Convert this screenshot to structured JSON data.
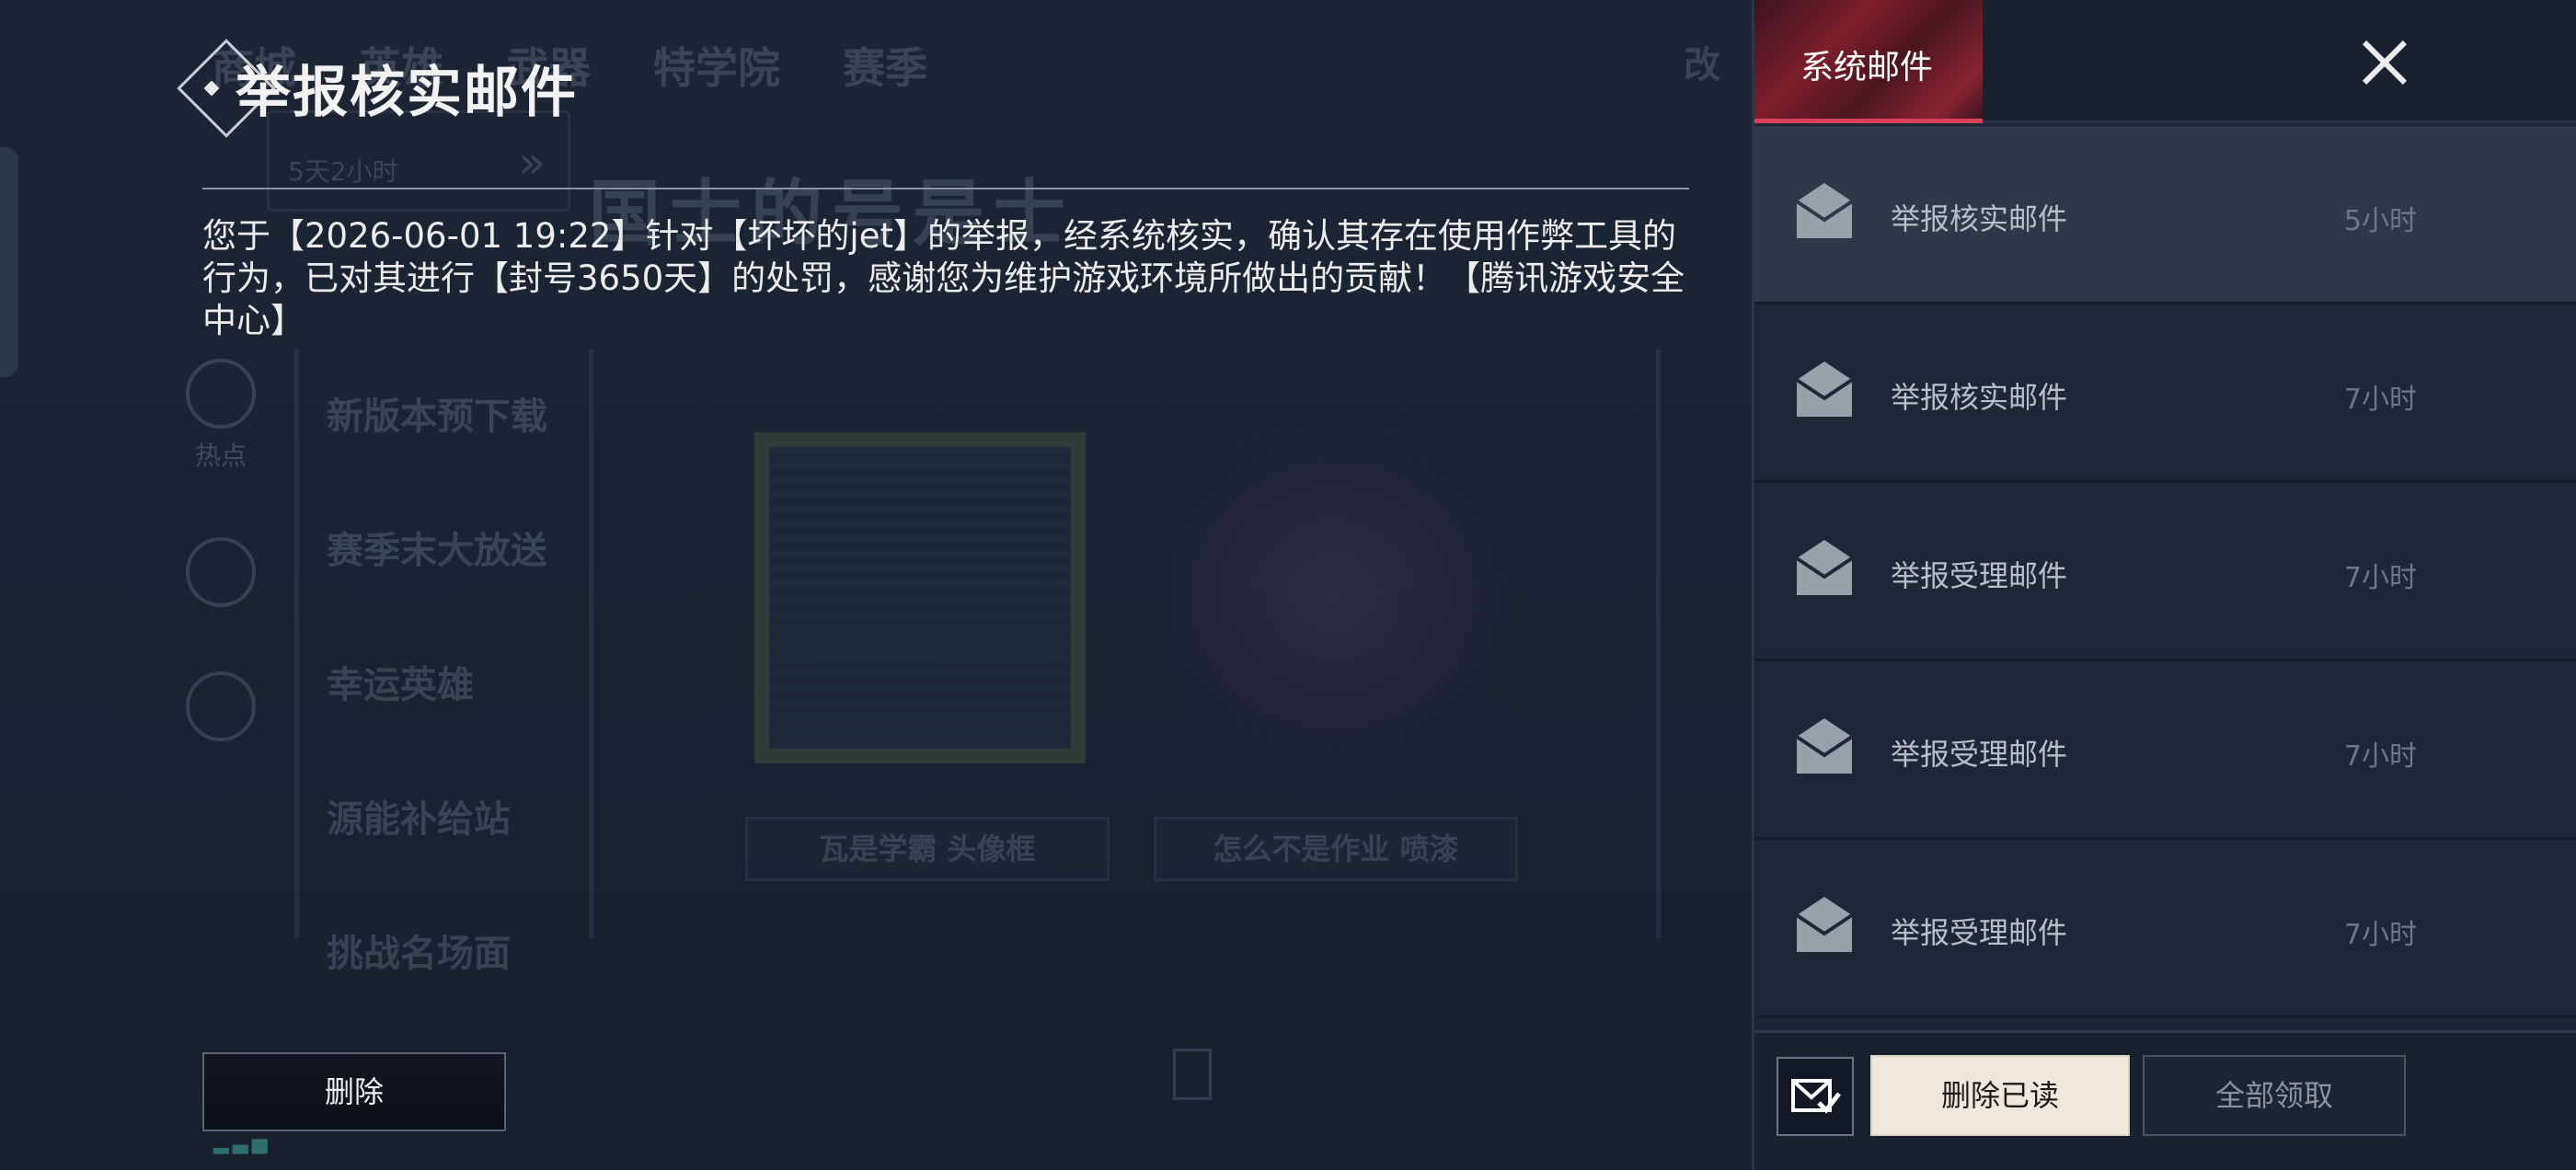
{
  "detail": {
    "title": "举报核实邮件",
    "body": "您于【2026-06-01 19:22】针对【坏坏的jet】的举报，经系统核实，确认其存在使用作弊工具的行为，已对其进行【封号3650天】的处罚，感谢您为维护游戏环境所做出的贡献！【腾讯游戏安全中心】",
    "delete_label": "删除"
  },
  "sidebar": {
    "tab_label": "系统邮件",
    "mails": [
      {
        "name": "举报核实邮件",
        "time": "5小时",
        "active": true
      },
      {
        "name": "举报核实邮件",
        "time": "7小时",
        "active": false
      },
      {
        "name": "举报受理邮件",
        "time": "7小时",
        "active": false
      },
      {
        "name": "举报受理邮件",
        "time": "7小时",
        "active": false
      },
      {
        "name": "举报受理邮件",
        "time": "7小时",
        "active": false
      }
    ],
    "delete_read_label": "删除已读",
    "claim_all_label": "全部领取"
  },
  "background": {
    "tabs": [
      "商城",
      "英雄",
      "武器",
      "特学院",
      "赛季",
      "改"
    ],
    "timer": "5天2小时",
    "banner": "国士的号是士",
    "side_label": "热点",
    "menu": [
      "新版本预下载",
      "赛季末大放送",
      "幸运英雄",
      "源能补给站",
      "挑战名场面"
    ],
    "tags": [
      "瓦是学霸 头像框",
      "怎么不是作业 喷漆"
    ]
  },
  "icons": {
    "envelope": "envelope-icon",
    "close": "close-icon",
    "mark_read": "mail-check-icon"
  },
  "colors": {
    "tab_accent": "#d9415a",
    "primary_button": "#efe8da"
  }
}
